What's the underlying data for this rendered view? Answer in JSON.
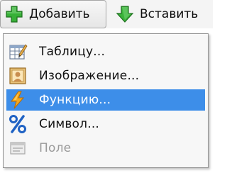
{
  "toolbar": {
    "add_label": "Добавить",
    "add_icon": "plus-icon",
    "paste_label": "Вставить",
    "paste_icon": "down-arrow-icon"
  },
  "menu": {
    "items": [
      {
        "label": "Таблицу...",
        "icon": "table-icon",
        "state": "normal"
      },
      {
        "label": "Изображение...",
        "icon": "image-icon",
        "state": "normal"
      },
      {
        "label": "Функцию...",
        "icon": "lightning-icon",
        "state": "highlighted"
      },
      {
        "label": "Символ...",
        "icon": "percent-icon",
        "state": "normal"
      },
      {
        "label": "Поле",
        "icon": "field-icon",
        "state": "disabled"
      }
    ]
  },
  "colors": {
    "highlight": "#3d8ee9",
    "disabled_text": "#9a9a9a",
    "plus_green": "#2e9e2e",
    "lightning_orange": "#f0a21c",
    "percent_blue": "#1f62c4"
  }
}
